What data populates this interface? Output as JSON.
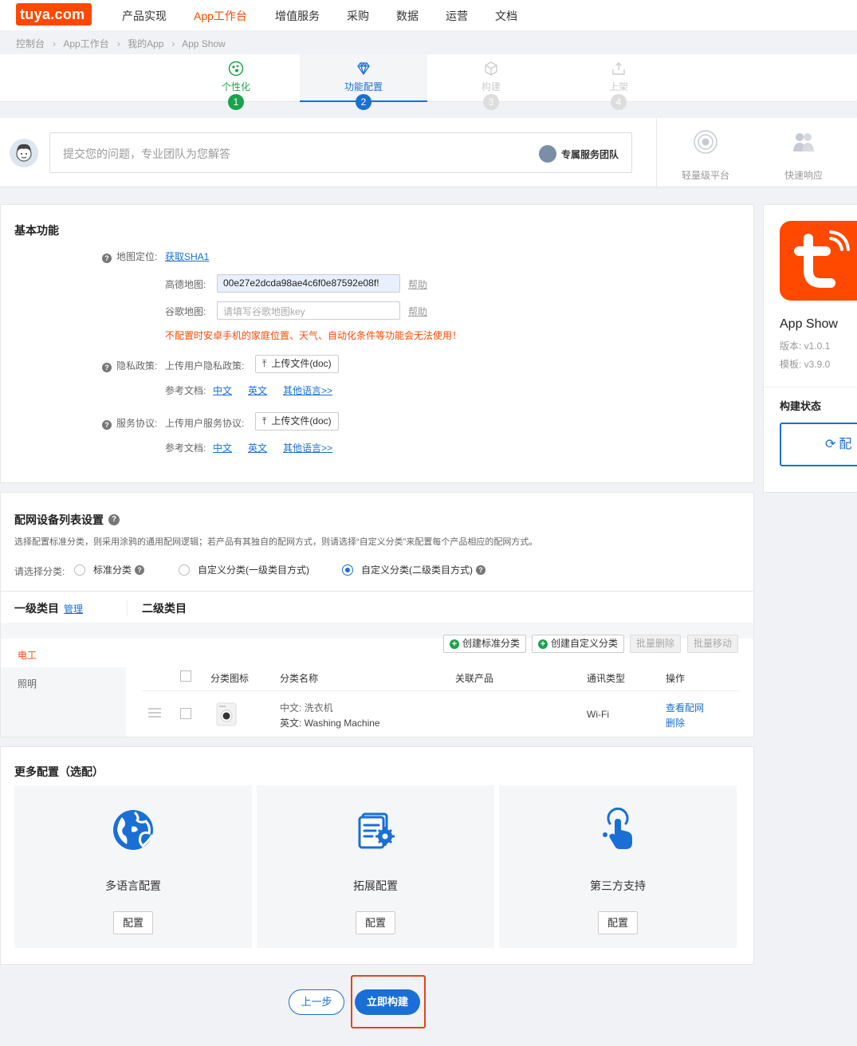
{
  "nav": {
    "logo": "tuya.com",
    "items": [
      "产品实现",
      "App工作台",
      "增值服务",
      "采购",
      "数据",
      "运营",
      "文档"
    ],
    "active": "App工作台"
  },
  "breadcrumb": [
    "控制台",
    "App工作台",
    "我的App",
    "App Show"
  ],
  "steps": [
    {
      "label": "个性化",
      "num": "1"
    },
    {
      "label": "功能配置",
      "num": "2"
    },
    {
      "label": "构建",
      "num": "3"
    },
    {
      "label": "上架",
      "num": "4"
    }
  ],
  "question": {
    "placeholder": "提交您的问题，专业团队为您解答",
    "team": "专属服务团队",
    "features": [
      "轻量级平台",
      "快速响应"
    ]
  },
  "basic": {
    "title": "基本功能",
    "map_label": "地图定位:",
    "map_link": "获取SHA1",
    "gaode_label": "高德地图:",
    "gaode_value": "00e27e2dcda98ae4c6f0e87592e08f!",
    "google_label": "谷歌地图:",
    "google_placeholder": "请填写谷歌地图key",
    "help": "帮助",
    "warning": "不配置时安卓手机的家庭位置、天气、自动化条件等功能会无法使用！",
    "privacy_label": "隐私政策:",
    "privacy_upload_label": "上传用户隐私政策:",
    "upload_btn": "上传文件(doc)",
    "ref_label": "参考文档:",
    "ref_cn": "中文",
    "ref_en": "英文",
    "ref_other": "其他语言>>",
    "service_label": "服务协议:",
    "service_upload_label": "上传用户服务协议:"
  },
  "network": {
    "title": "配网设备列表设置",
    "desc": "选择配置标准分类，则采用涂鸦的通用配网逻辑；若产品有其独自的配网方式，则请选择“自定义分类”来配置每个产品相应的配网方式。",
    "choose_label": "请选择分类:",
    "options": [
      "标准分类",
      "自定义分类(一级类目方式)",
      "自定义分类(二级类目方式)"
    ],
    "level1": "一级类目",
    "manage": "管理",
    "level2": "二级类目",
    "categories": [
      "电工",
      "照明"
    ],
    "buttons": [
      "创建标准分类",
      "创建自定义分类",
      "批量删除",
      "批量移动"
    ],
    "columns": [
      "分类图标",
      "分类名称",
      "关联产品",
      "通讯类型",
      "操作"
    ],
    "row": {
      "name_cn": "中文: 洗衣机",
      "name_en": "英文: Washing Machine",
      "comm": "Wi-Fi",
      "op_view": "查看配网",
      "op_delete": "删除"
    }
  },
  "more": {
    "title": "更多配置（选配）",
    "cards": [
      {
        "label": "多语言配置",
        "btn": "配置"
      },
      {
        "label": "拓展配置",
        "btn": "配置"
      },
      {
        "label": "第三方支持",
        "btn": "配置"
      }
    ]
  },
  "sidebar": {
    "app_name": "App Show",
    "version": "版本: v1.0.1",
    "template": "模板: v3.9.0",
    "build_status": "构建状态",
    "status_btn": "配"
  },
  "footer": {
    "prev": "上一步",
    "build": "立即构建"
  },
  "colors": {
    "accent": "#1a6fd4",
    "brand": "#ff4800",
    "success": "#1aa34a",
    "warning": "#ff4800"
  }
}
